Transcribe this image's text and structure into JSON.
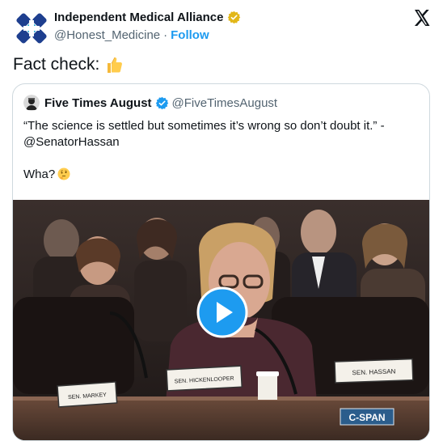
{
  "author": {
    "name": "Independent Medical Alliance",
    "handle": "@Honest_Medicine",
    "separator": "·",
    "follow_label": "Follow"
  },
  "tweet": {
    "text": "Fact check:"
  },
  "quoted": {
    "name": "Five Times August",
    "handle": "@FiveTimesAugust",
    "line1": "“The science is settled but sometimes it’s wrong so don’t doubt it.” -",
    "line2": "@SenatorHassan",
    "line3": "Wha?"
  },
  "video": {
    "placards": [
      "SEN. MARKEY",
      "SEN. HICKENLOOPER",
      "SEN. HASSAN"
    ],
    "network_logo": "C-SPAN"
  },
  "colors": {
    "link_blue": "#1d9bf0",
    "verified_gold": "#e2b719",
    "text_primary": "#0f1419",
    "text_secondary": "#536471"
  },
  "icons": {
    "verified_org": "gold-verified-badge",
    "verified_user": "blue-verified-badge",
    "platform": "x-logo",
    "play": "play-button"
  }
}
